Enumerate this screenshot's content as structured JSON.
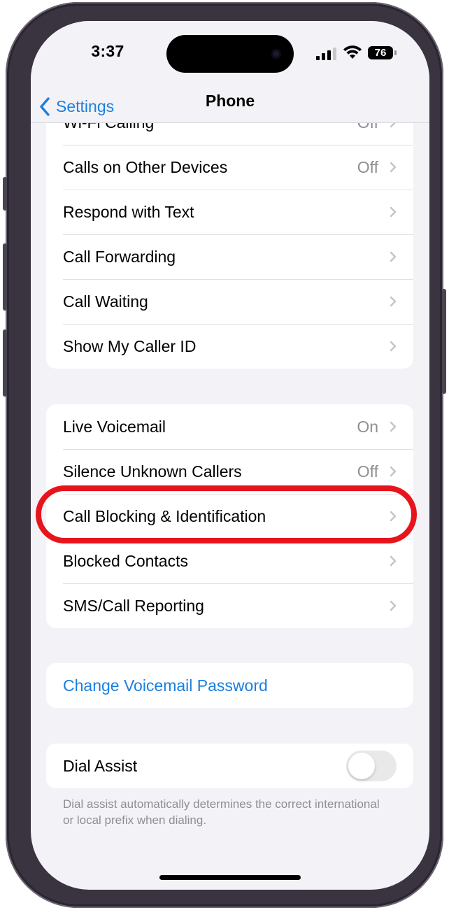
{
  "status_bar": {
    "time": "3:37",
    "battery": "76"
  },
  "nav": {
    "back_label": "Settings",
    "title": "Phone"
  },
  "group1": [
    {
      "label": "Wi-Fi Calling",
      "value": "Off"
    },
    {
      "label": "Calls on Other Devices",
      "value": "Off"
    },
    {
      "label": "Respond with Text",
      "value": ""
    },
    {
      "label": "Call Forwarding",
      "value": ""
    },
    {
      "label": "Call Waiting",
      "value": ""
    },
    {
      "label": "Show My Caller ID",
      "value": ""
    }
  ],
  "group2": [
    {
      "label": "Live Voicemail",
      "value": "On"
    },
    {
      "label": "Silence Unknown Callers",
      "value": "Off"
    },
    {
      "label": "Call Blocking & Identification",
      "value": ""
    },
    {
      "label": "Blocked Contacts",
      "value": ""
    },
    {
      "label": "SMS/Call Reporting",
      "value": ""
    }
  ],
  "voicemail": {
    "label": "Change Voicemail Password"
  },
  "dial_assist": {
    "label": "Dial Assist",
    "enabled": false,
    "footnote": "Dial assist automatically determines the correct international or local prefix when dialing."
  },
  "colors": {
    "accent": "#1a7fe0",
    "highlight": "#e8141c",
    "background": "#f2f2f7"
  },
  "icons": {
    "back": "chevron-left-icon",
    "row_disclosure": "chevron-right-icon"
  }
}
